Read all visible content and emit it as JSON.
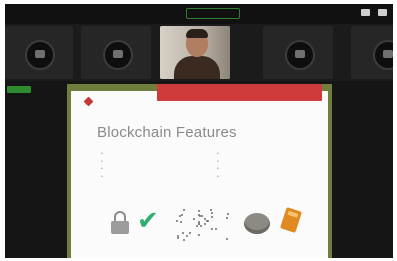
{
  "topbar": {
    "left_title": "",
    "view_label": ""
  },
  "gallery": {
    "tiles": [
      {
        "name": ""
      },
      {
        "name": ""
      },
      {
        "name": ""
      },
      {
        "name": ""
      },
      {
        "name": ""
      }
    ]
  },
  "slide": {
    "brand": "",
    "title": "Blockchain Features",
    "col1": [
      "",
      "",
      "",
      ""
    ],
    "col2": [
      "",
      "",
      "",
      ""
    ]
  },
  "share": {
    "banner": ""
  },
  "colors": {
    "share_bar": "#cf3b3b",
    "badge": "#2e8b2e",
    "check": "#2fae6f",
    "calculator": "#e08a22"
  },
  "icons": [
    "lock-icon",
    "checkmark-icon",
    "network-dots-icon",
    "coin-icon",
    "calculator-icon"
  ]
}
